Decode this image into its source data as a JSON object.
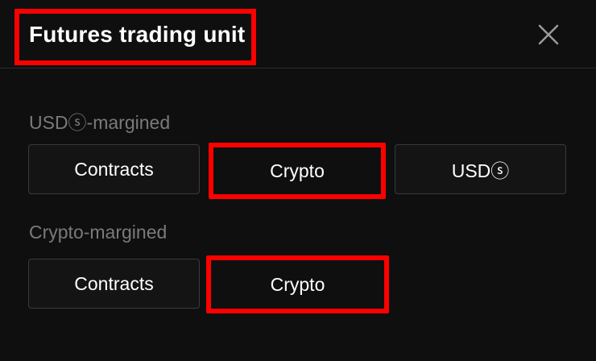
{
  "dialog": {
    "title": "Futures trading unit",
    "close_icon": "close-icon"
  },
  "sections": [
    {
      "label": "USDⓢ-margined",
      "options": [
        "Contracts",
        "Crypto",
        "USDⓢ"
      ],
      "selected": "Crypto"
    },
    {
      "label": "Crypto-margined",
      "options": [
        "Contracts",
        "Crypto"
      ],
      "selected": "Crypto"
    }
  ],
  "colors": {
    "background": "#0f0f0f",
    "highlight": "#ff0000",
    "label_text": "#7a7a7a",
    "button_text": "#ffffff"
  }
}
